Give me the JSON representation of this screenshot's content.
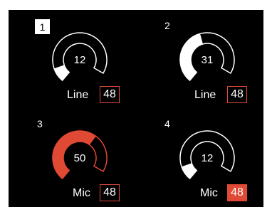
{
  "colors": {
    "background": "#000000",
    "ring": "#ffffff",
    "active": "#e04a35"
  },
  "channels": [
    {
      "number": "1",
      "selected": true,
      "value": "12",
      "level": 0.12,
      "mode": "Line",
      "gain": "48",
      "gain_active": false,
      "ring_color": "#ffffff"
    },
    {
      "number": "2",
      "selected": false,
      "value": "31",
      "level": 0.48,
      "mode": "Line",
      "gain": "48",
      "gain_active": false,
      "ring_color": "#ffffff"
    },
    {
      "number": "3",
      "selected": false,
      "value": "50",
      "level": 0.68,
      "mode": "Mic",
      "gain": "48",
      "gain_active": false,
      "ring_color": "#e04a35"
    },
    {
      "number": "4",
      "selected": false,
      "value": "12",
      "level": 0.12,
      "mode": "Mic",
      "gain": "48",
      "gain_active": true,
      "ring_color": "#ffffff"
    }
  ]
}
